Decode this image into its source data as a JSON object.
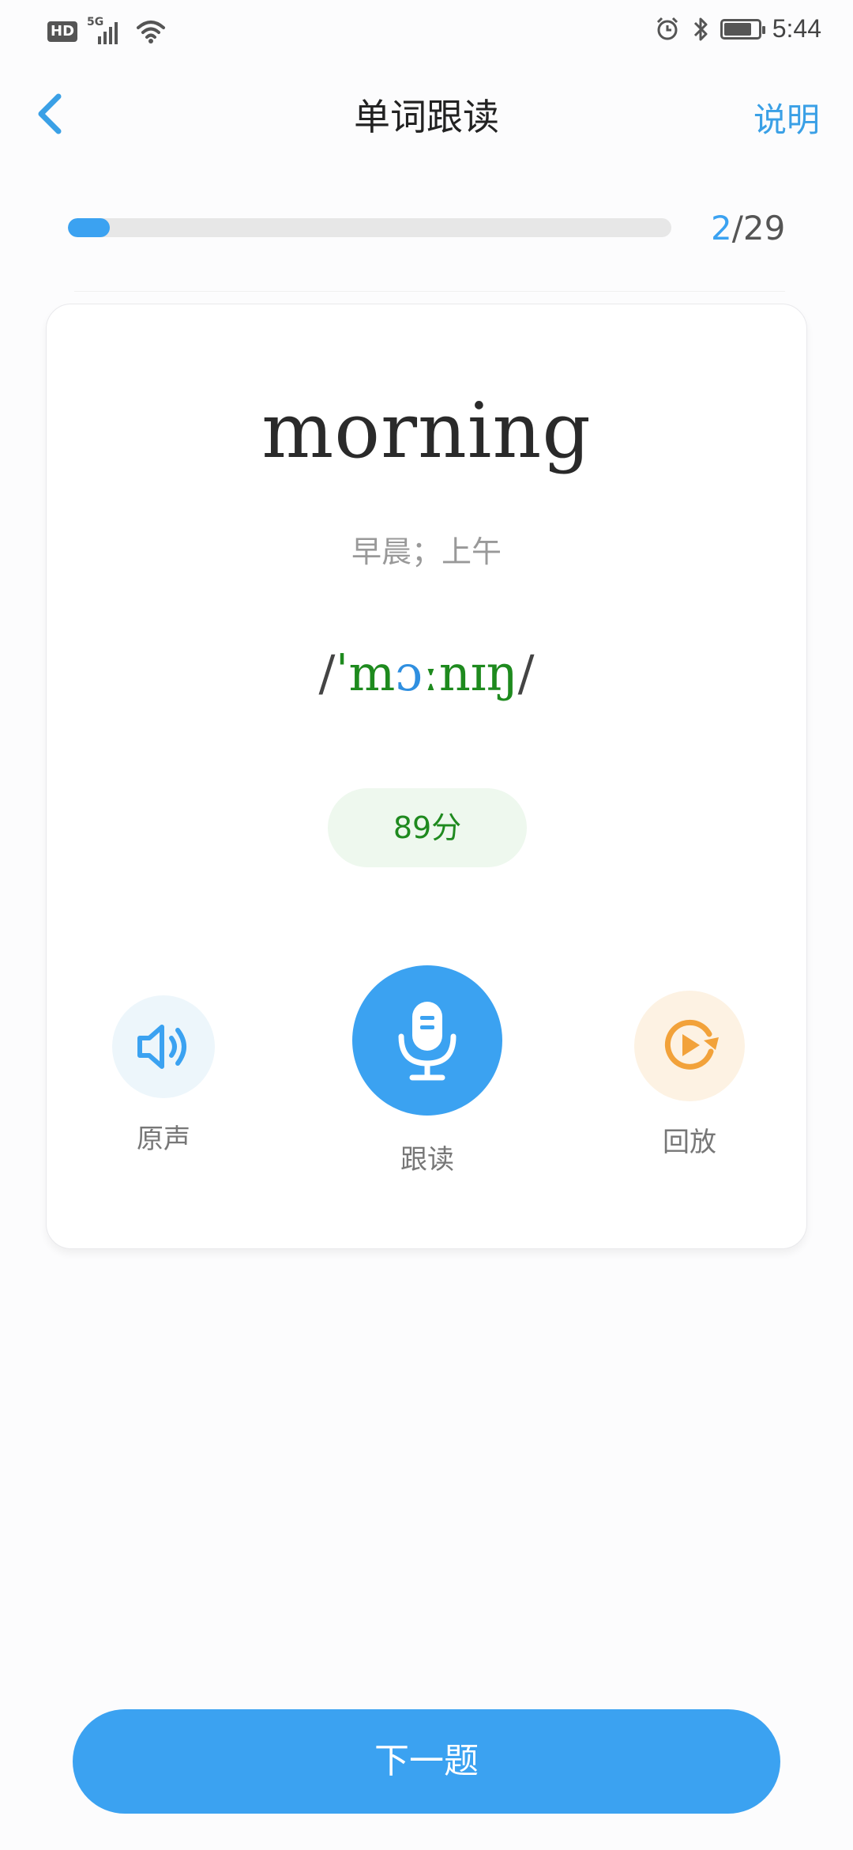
{
  "status": {
    "hd": "HD",
    "network": "5G",
    "time": "5:44",
    "battery_level": 0.85
  },
  "nav": {
    "title": "单词跟读",
    "help_label": "说明"
  },
  "progress": {
    "current": "2",
    "total": "/29",
    "fraction": 0.069
  },
  "word": {
    "text": "morning",
    "meaning": "早晨；上午",
    "phonetic": {
      "open": "/",
      "stress": "ˈ",
      "seg1": "m",
      "seg2": "ɔ",
      "seg3": "ː",
      "seg4": "nɪŋ",
      "close": "/"
    },
    "score": "89分"
  },
  "actions": {
    "original_label": "原声",
    "record_label": "跟读",
    "playback_label": "回放"
  },
  "next_label": "下一题",
  "colors": {
    "accent": "#3ba2f1",
    "good": "#1f8a1f",
    "playback": "#f2a23a"
  }
}
